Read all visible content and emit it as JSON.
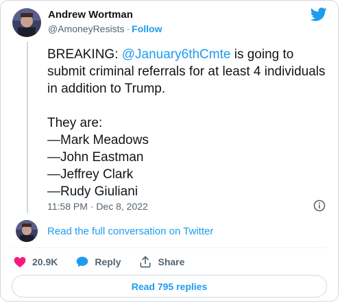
{
  "author": {
    "name": "Andrew Wortman",
    "handle": "@AmoneyResists",
    "separator": "·",
    "follow_label": "Follow",
    "avatar": "profile-photo"
  },
  "tweet": {
    "breaking_prefix": "BREAKING: ",
    "mention": "@January6thCmte",
    "breaking_suffix": " is going to submit criminal referrals for at least 4 individuals in addition to Trump.",
    "list_intro": "They are:",
    "names": [
      "—Mark Meadows",
      "—John Eastman",
      "—Jeffrey Clark",
      "—Rudy Giuliani"
    ],
    "timestamp": "11:58 PM · Dec 8, 2022"
  },
  "conversation": {
    "read_link": "Read the full conversation on Twitter"
  },
  "actions": {
    "likes_count": "20.9K",
    "reply_label": "Reply",
    "share_label": "Share"
  },
  "replies": {
    "label": "Read 795 replies"
  },
  "colors": {
    "accent": "#1d9bf0",
    "heart": "#f91880",
    "text": "#0f1419",
    "muted": "#536471"
  }
}
